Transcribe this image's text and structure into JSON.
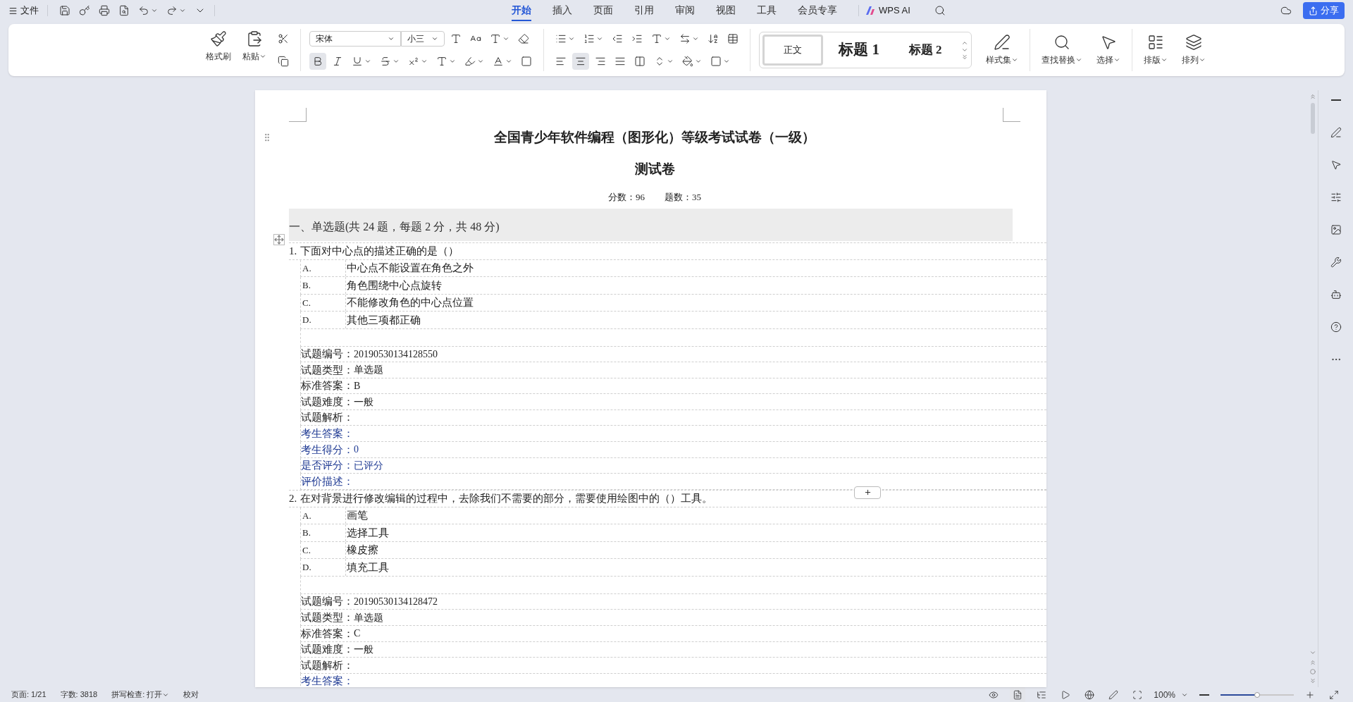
{
  "menubar": {
    "file": "文件",
    "tabs": [
      {
        "label": "开始",
        "selected": true
      },
      {
        "label": "插入",
        "selected": false
      },
      {
        "label": "页面",
        "selected": false
      },
      {
        "label": "引用",
        "selected": false
      },
      {
        "label": "审阅",
        "selected": false
      },
      {
        "label": "视图",
        "selected": false
      },
      {
        "label": "工具",
        "selected": false
      },
      {
        "label": "会员专享",
        "selected": false
      }
    ],
    "ai": "WPS AI",
    "share": "分享"
  },
  "ribbon": {
    "format_painter": "格式刷",
    "paste": "粘贴",
    "font": "宋体",
    "font_size": "小三",
    "styles": [
      {
        "label": "正文",
        "kind": "body",
        "selected": true
      },
      {
        "label": "标题 1",
        "kind": "h1",
        "selected": false
      },
      {
        "label": "标题 2",
        "kind": "h2",
        "selected": false
      }
    ],
    "style_set": "样式集",
    "find_replace": "查找替换",
    "select": "选择",
    "layout": "排版",
    "arrange": "排列"
  },
  "document": {
    "title": "全国青少年软件编程（图形化）等级考试试卷（一级）",
    "subtitle": "测试卷",
    "score": "分数：96",
    "count": "题数：35",
    "section": "一、单选题(共 24 题，每题 2 分，共 48 分)",
    "questions": [
      {
        "number": "1.",
        "text": "下面对中心点的描述正确的是（）",
        "options": [
          {
            "letter": "A.",
            "text": "中心点不能设置在角色之外"
          },
          {
            "letter": "B.",
            "text": "角色围绕中心点旋转"
          },
          {
            "letter": "C.",
            "text": "不能修改角色的中心点位置"
          },
          {
            "letter": "D.",
            "text": "其他三项都正确"
          }
        ],
        "info": [
          {
            "kind": "plain",
            "label": "试题编号：",
            "value": "20190530134128550"
          },
          {
            "kind": "plain",
            "label": "试题类型：",
            "value": "单选题"
          },
          {
            "kind": "plain",
            "label": "标准答案：",
            "value": "B"
          },
          {
            "kind": "plain",
            "label": "试题难度：",
            "value": "一般"
          },
          {
            "kind": "plain",
            "label": "试题解析："
          },
          {
            "kind": "student",
            "label": "考生答案："
          },
          {
            "kind": "student",
            "label": "考生得分：",
            "value": "0"
          },
          {
            "kind": "student",
            "label": "是否评分：",
            "value": "已评分"
          },
          {
            "kind": "student",
            "label": "评价描述："
          }
        ]
      },
      {
        "number": "2.",
        "text": "在对背景进行修改编辑的过程中，去除我们不需要的部分，需要使用绘图中的（）工具。",
        "options": [
          {
            "letter": "A.",
            "text": "画笔"
          },
          {
            "letter": "B.",
            "text": "选择工具"
          },
          {
            "letter": "C.",
            "text": "橡皮擦"
          },
          {
            "letter": "D.",
            "text": "填充工具"
          }
        ],
        "info": [
          {
            "kind": "plain",
            "label": "试题编号：",
            "value": "20190530134128472"
          },
          {
            "kind": "plain",
            "label": "试题类型：",
            "value": "单选题"
          },
          {
            "kind": "plain",
            "label": "标准答案：",
            "value": "C"
          },
          {
            "kind": "plain",
            "label": "试题难度：",
            "value": "一般"
          },
          {
            "kind": "plain",
            "label": "试题解析："
          },
          {
            "kind": "student",
            "label": "考生答案："
          }
        ]
      }
    ]
  },
  "status_bar": {
    "page": "页面: 1/21",
    "words": "字数: 3818",
    "spell": "拼写检查: 打开",
    "proof": "校对",
    "zoom": "100%",
    "zoom_slider": {
      "level": 0.5
    }
  }
}
